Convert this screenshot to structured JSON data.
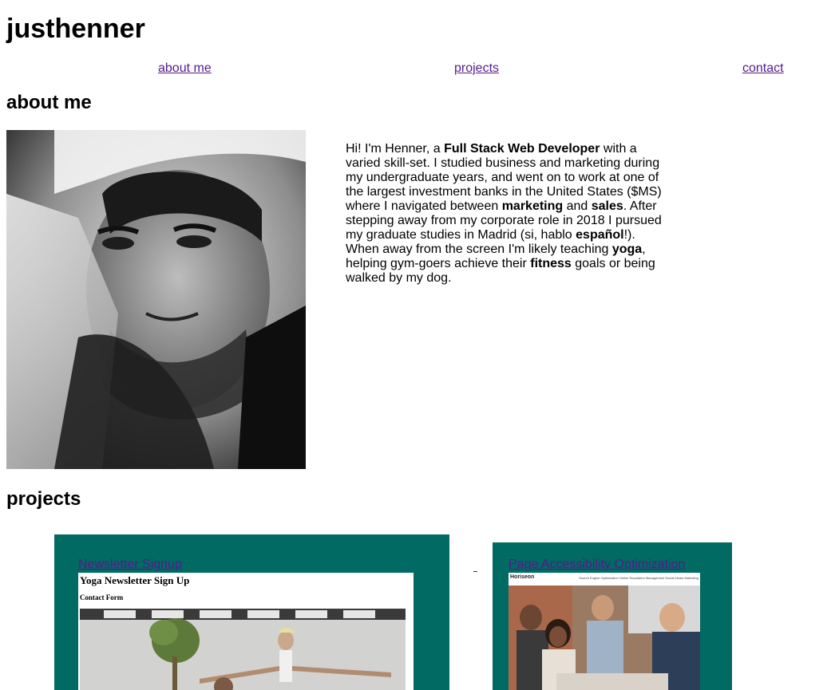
{
  "site": {
    "title": "justhenner"
  },
  "nav": {
    "about": "about me",
    "projects": "projects",
    "contact": "contact"
  },
  "about": {
    "heading": "about me",
    "bio": {
      "p1": "Hi! I'm Henner, a ",
      "b1": "Full Stack Web Developer",
      "p2": " with a varied skill-set. I studied business and marketing during my undergraduate years, and went on to work at one of the largest investment banks in the United States ($MS) where I navigated between ",
      "b2": "marketing",
      "p3": " and ",
      "b3": "sales",
      "p4": ". After stepping away from my corporate role in 2018 I pursued my graduate studies in Madrid (si, hablo ",
      "b4": "español",
      "p5": "!). When away from the screen I'm likely teaching ",
      "b5": "yoga",
      "p6": ", helping gym-goers achieve their ",
      "b6": "fitness",
      "p7": " goals or being walked by my dog."
    }
  },
  "projects": {
    "heading": "projects",
    "items": [
      {
        "title": "Newsletter Signup",
        "screenshot": {
          "title": "Yoga Newsletter Sign Up",
          "subtitle": "Contact Form"
        }
      },
      {
        "title": "Page Accessibility Optimization",
        "screenshot": {
          "logo": "Horiseon",
          "nav": "Search Engine Optimization   Online Reputation Management   Social Media Marketing"
        }
      }
    ]
  },
  "colors": {
    "card_bg": "#006a63",
    "link": "#551a8b"
  }
}
